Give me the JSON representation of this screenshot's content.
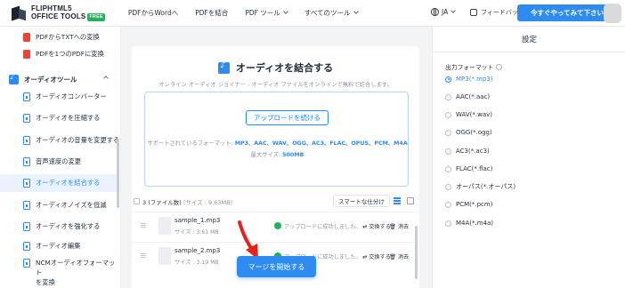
{
  "header": {
    "logo_line1": "FLIPHTML5",
    "logo_line2": "OFFICE TOOLS",
    "logo_badge": "FREE",
    "nav": [
      "PDFからWordへ",
      "PDFを結合",
      "PDF ツール",
      "すべてのツール"
    ],
    "lang": "JA",
    "feedback": "フィードバック",
    "cta": "今すぐやってみて下さい"
  },
  "sidebar": {
    "items_top": [
      "PDFからTXTへの変換",
      "PDFを1つのPDFに変換"
    ],
    "category": "オーディオツール",
    "items": [
      "オーディオコンバーター",
      "オーディオを圧縮する",
      "オーディオの音量を変更する",
      "音声速度の変更",
      "オーディオを結合する",
      "オーディオノイズを低減",
      "オーディオを強化する",
      "オーディオ編集"
    ],
    "ncm_line1": "NCMオーディオフォーマット",
    "ncm_line2": "を変換"
  },
  "main": {
    "title": "オーディオを結合する",
    "subtitle": "オンライン オーディオ ジョイナー - オーディオ ファイルをオンラインで無料で結合します。",
    "upload_button": "アップロードを続ける",
    "formats_label": "サポートされているフォーマット: ",
    "formats_value": "MP3、AAC、WAV、OGG、AC3、FLAC、OPUS、PCM、M4A",
    "maxsize_label": "最大サイズ: ",
    "maxsize_value": "500MB",
    "count_label": "3 (ファイル数)",
    "count_size": " (サイズ : 9.63MB)",
    "smart_sort": "スマートな仕分け",
    "files": [
      {
        "name": "sample_1.mp3",
        "size": "サイズ : 3.61 MB",
        "status": "アップロードに成功しました。",
        "replace": "⇄ 交換する",
        "delete": "🗑 消去"
      },
      {
        "name": "sample_2.mp3",
        "size": "サイズ : 3.19 MB",
        "status": "アップロードに成功しました。",
        "replace": "⇄ 交換する",
        "delete": "🗑 消去"
      }
    ],
    "merge_button": "マージを開始する"
  },
  "settings": {
    "title": "設定",
    "output_label": "出力フォーマット",
    "formats": [
      "MP3(*.mp3)",
      "AAC(*.aac)",
      "WAV(*.wav)",
      "OGG(*.ogg)",
      "AC3(*.ac3)",
      "FLAC(*.flac)",
      "オーパス(*.オーパス)",
      "PCM(*.pcm)",
      "M4A(*.m4a)"
    ],
    "selected": "MP3(*.mp3)"
  },
  "colors": {
    "accent": "#2e8bf0",
    "success": "#20b35a",
    "pdf": "#e8443a",
    "arrow": "#e8221b"
  }
}
